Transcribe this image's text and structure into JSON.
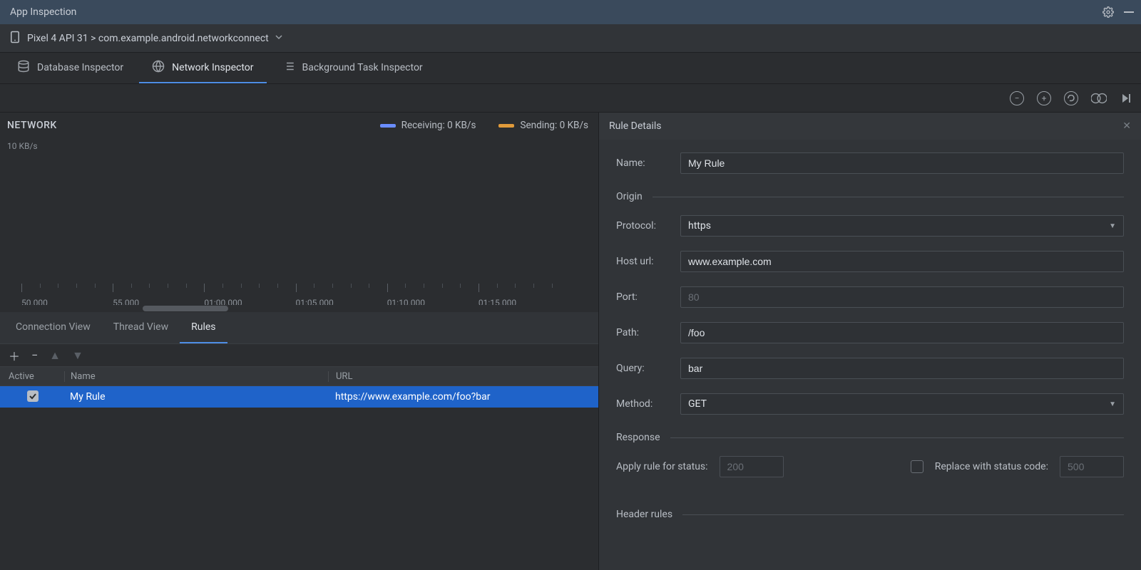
{
  "window": {
    "title": "App Inspection"
  },
  "device": {
    "breadcrumb": "Pixel 4 API 31 > com.example.android.networkconnect"
  },
  "inspector_tabs": {
    "db": "Database Inspector",
    "net": "Network Inspector",
    "bg": "Background Task Inspector",
    "active": "net"
  },
  "timeline": {
    "title": "NETWORK",
    "yaxis": "10 KB/s",
    "legend_rx": "Receiving: 0 KB/s",
    "legend_tx": "Sending: 0 KB/s",
    "ticks": [
      "50.000",
      "55.000",
      "01:00.000",
      "01:05.000",
      "01:10.000",
      "01:15.000"
    ]
  },
  "view_tabs": {
    "connection": "Connection View",
    "thread": "Thread View",
    "rules": "Rules",
    "active": "rules"
  },
  "rules_table": {
    "headers": {
      "active": "Active",
      "name": "Name",
      "url": "URL"
    },
    "rows": [
      {
        "active": true,
        "name": "My Rule",
        "url": "https://www.example.com/foo?bar"
      }
    ]
  },
  "rule_details": {
    "panel_title": "Rule Details",
    "name_label": "Name:",
    "name_value": "My Rule",
    "origin_section": "Origin",
    "protocol_label": "Protocol:",
    "protocol_value": "https",
    "host_label": "Host url:",
    "host_value": "www.example.com",
    "port_label": "Port:",
    "port_placeholder": "80",
    "path_label": "Path:",
    "path_value": "/foo",
    "query_label": "Query:",
    "query_value": "bar",
    "method_label": "Method:",
    "method_value": "GET",
    "response_section": "Response",
    "apply_status_label": "Apply rule for status:",
    "apply_status_placeholder": "200",
    "replace_status_label": "Replace with status code:",
    "replace_status_placeholder": "500",
    "header_rules_section": "Header rules"
  }
}
